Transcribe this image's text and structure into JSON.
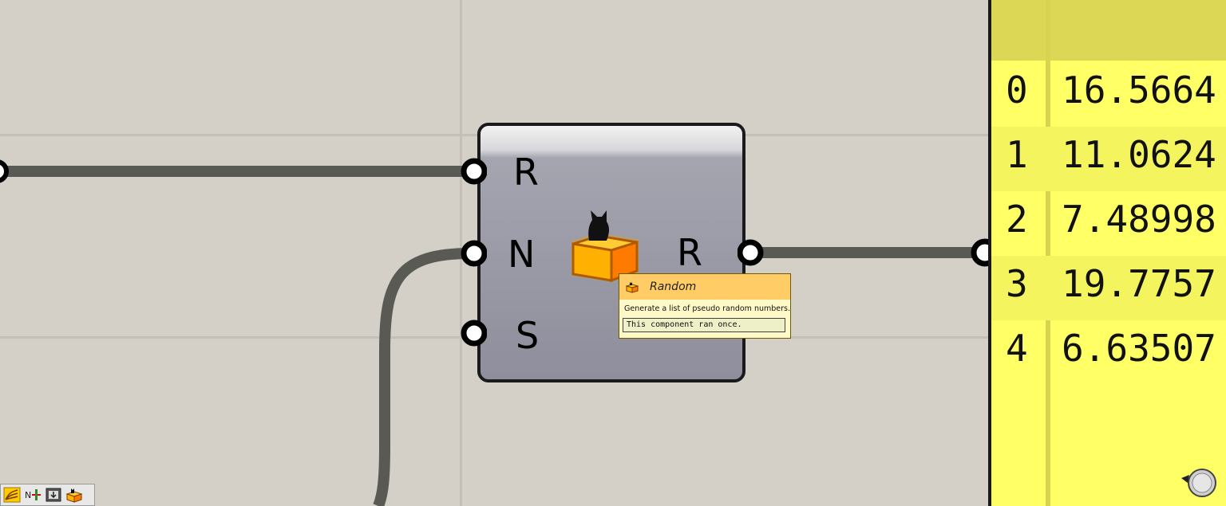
{
  "component": {
    "name": "Random",
    "inputs": [
      "R",
      "N",
      "S"
    ],
    "outputs": [
      "R"
    ]
  },
  "tooltip": {
    "title": "Random",
    "description": "Generate a list of pseudo random numbers.",
    "message": "This component ran once."
  },
  "panel": {
    "rows": [
      {
        "index": "0",
        "value": "16.5664"
      },
      {
        "index": "1",
        "value": "11.0624"
      },
      {
        "index": "2",
        "value": "7.48998"
      },
      {
        "index": "3",
        "value": "19.7757"
      },
      {
        "index": "4",
        "value": "6.63507"
      }
    ]
  },
  "colors": {
    "canvas_bg": "#d4d0c8",
    "wire": "#5a5a55",
    "panel_bg": "#ffff66",
    "tooltip_header": "#ffcc66"
  },
  "toolbar": {
    "icons": [
      "wires-icon",
      "number-slider-icon",
      "panel-icon",
      "random-icon"
    ]
  }
}
